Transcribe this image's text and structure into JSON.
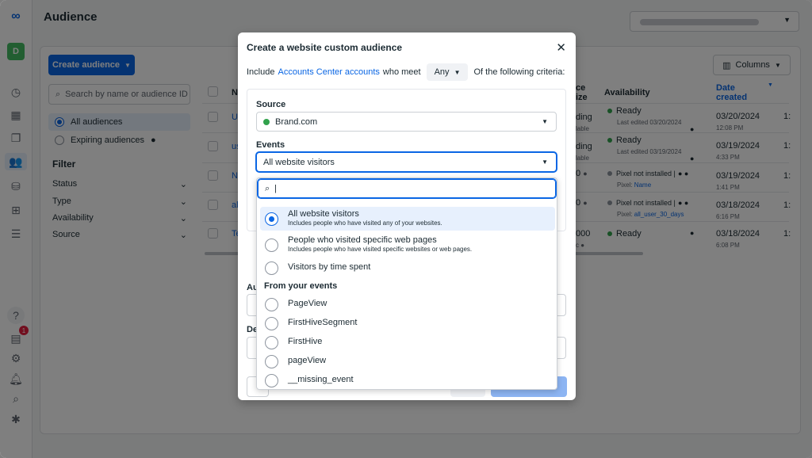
{
  "app": {
    "page_title": "Audience",
    "rail_avatar": "D",
    "notification_count": "1"
  },
  "toolbar": {
    "create_label": "Create audience",
    "columns_label": "Columns"
  },
  "sidebar": {
    "search_placeholder": "Search by name or audience ID",
    "filters": [
      {
        "label": "All audiences"
      },
      {
        "label": "Expiring audiences"
      }
    ],
    "filter_heading": "Filter",
    "filter_rows": [
      "Status",
      "Type",
      "Availability",
      "Source"
    ]
  },
  "table": {
    "headers": {
      "name": "N",
      "size": "ce\nize",
      "availability": "Availability",
      "date": "Date created"
    },
    "rows": [
      {
        "name": "U",
        "size": "ding",
        "size_sub": "lable",
        "availability": "Ready",
        "availability_sub": "Last edited 03/20/2024",
        "date": "03/20/2024",
        "time": "12:08 PM",
        "extra": "1:"
      },
      {
        "name": "us",
        "size": "ding",
        "size_sub": "lable",
        "availability": "Ready",
        "availability_sub": "Last edited 03/19/2024",
        "date": "03/19/2024",
        "time": "4:33 PM",
        "extra": "1:"
      },
      {
        "name": "N",
        "size": "0",
        "size_sub": "",
        "availability": "Pixel not installed |",
        "availability_sub_prefix": "Pixel: ",
        "availability_sub_link": "Name",
        "date": "03/19/2024",
        "time": "1:41 PM",
        "extra": "1:"
      },
      {
        "name": "al",
        "size": "0",
        "size_sub": "",
        "availability": "Pixel not installed |",
        "availability_sub_prefix": "Pixel: ",
        "availability_sub_link": "all_user_30_days",
        "date": "03/18/2024",
        "time": "6:16 PM",
        "extra": "1:"
      },
      {
        "name": "Te",
        "size": "000",
        "size_sub": "c",
        "availability": "Ready",
        "availability_sub": "",
        "date": "03/18/2024",
        "time": "6:08 PM",
        "extra": "1:"
      }
    ]
  },
  "modal": {
    "title": "Create a website custom audience",
    "include_prefix": "Include",
    "include_link": "Accounts Center accounts",
    "include_mid": "who meet",
    "any_label": "Any",
    "include_suffix": "Of the following criteria:",
    "source_label": "Source",
    "source_value": "Brand.com",
    "events_label": "Events",
    "events_value": "All website visitors",
    "hidden_label_1": "Au",
    "hidden_label_2": "De"
  },
  "dropdown": {
    "search_value": "|",
    "options": [
      {
        "title": "All website visitors",
        "desc": "Includes people who have visited any of your websites."
      },
      {
        "title": "People who visited specific web pages",
        "desc": "Includes people who have visited specific websites or web pages."
      },
      {
        "title": "Visitors by time spent",
        "desc": ""
      }
    ],
    "group_label": "From your events",
    "events": [
      "PageView",
      "FirstHiveSegment",
      "FirstHive",
      "pageView",
      "__missing_event"
    ]
  },
  "colors": {
    "accent": "#0a66e4",
    "ready": "#31a24c",
    "overlay": "rgba(0,0,0,0.5)"
  }
}
